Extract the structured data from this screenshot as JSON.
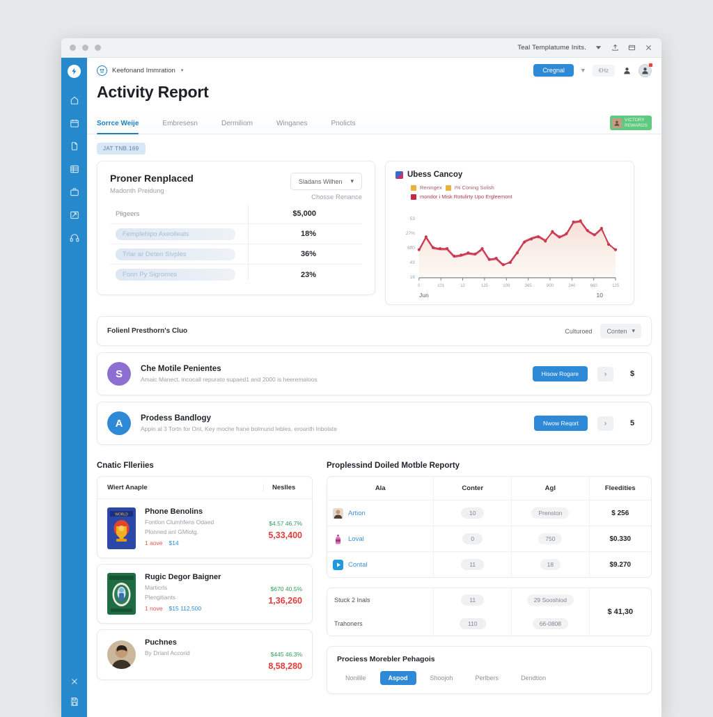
{
  "titlebar": {
    "title": "Teal Templatume Inits.",
    "icons": [
      "chevron-down-icon",
      "share-icon",
      "window-icon",
      "close-icon"
    ]
  },
  "sidebar": {
    "logo": "app-logo-icon",
    "items": [
      {
        "name": "home-icon"
      },
      {
        "name": "calendar-icon"
      },
      {
        "name": "document-icon"
      },
      {
        "name": "table-icon"
      },
      {
        "name": "briefcase-icon"
      },
      {
        "name": "send-icon"
      },
      {
        "name": "headset-icon"
      }
    ],
    "bottom": [
      {
        "name": "close-icon"
      },
      {
        "name": "save-icon"
      }
    ]
  },
  "topbar": {
    "brand": "Keefonand Immration",
    "brand_caret": "▾",
    "primary_button": "Cregnal",
    "filter_icon": "filter-icon",
    "ghost_pill": "€Hz",
    "user_icon": "user-icon",
    "avatar_icon": "avatar-icon"
  },
  "page_title": "Activity Report",
  "tabs": [
    {
      "label": "Sorrce Weije",
      "active": true
    },
    {
      "label": "Embresesn",
      "active": false
    },
    {
      "label": "Dermiliom",
      "active": false
    },
    {
      "label": "Winganes",
      "active": false
    },
    {
      "label": "Pnolicts",
      "active": false
    }
  ],
  "tab_badge": {
    "line1": "VICTORY",
    "line2": "REWARDS"
  },
  "filter_chip": "JAT TNB.169",
  "metrics": {
    "title": "Proner Renplaced",
    "subtitle": "Madonth Preidung",
    "select_value": "Sladans Wilhen",
    "choose_label": "Chosse Renance",
    "rows": [
      {
        "label": "Pligeers",
        "value": "$5,000",
        "skeleton": false
      },
      {
        "label": "Femplehipo Axeolleats",
        "value": "18%",
        "skeleton": true
      },
      {
        "label": "Trlar ar Deten Sivples",
        "value": "36%",
        "skeleton": true
      },
      {
        "label": "Fonn Py Sigromes",
        "value": "23%",
        "skeleton": true
      }
    ]
  },
  "chart_data": {
    "type": "line",
    "title": "Ubess Cancoy",
    "legend": [
      {
        "label": "Reningex",
        "color": "#e8b23c"
      },
      {
        "label": "I% Coning Solish",
        "color": "#e8b23c"
      },
      {
        "label": "mondor i Misk Rotulirty Upo Ergleemont",
        "color": "#c02a42"
      }
    ],
    "legend_position": "top-left",
    "grid": false,
    "xlabel": "",
    "ylabel": "",
    "ytick_labels": [
      "53",
      "27%",
      "6ff0",
      "43",
      "16"
    ],
    "xtick_labels": [
      "0",
      "101",
      "12",
      "125",
      "109",
      "365",
      "900",
      "240",
      "660",
      "125"
    ],
    "xaxis_captions": [
      "Jun",
      "10"
    ],
    "ylim": [
      0,
      100
    ],
    "series": [
      {
        "name": "mondor i Misk Rotulirty Upo Ergleemont",
        "color": "#c8394f",
        "values": [
          50,
          62,
          52,
          51,
          51,
          44,
          45,
          47,
          46,
          51,
          41,
          42,
          36,
          38,
          47,
          57,
          60,
          62,
          58,
          67,
          62,
          65,
          76,
          77,
          68,
          64,
          70,
          55,
          50
        ]
      },
      {
        "name": "Reningex",
        "color": "#d9536b",
        "values": [
          49,
          61,
          51,
          50,
          50,
          43,
          44,
          46,
          45,
          50,
          40,
          41,
          35,
          39,
          48,
          58,
          61,
          63,
          59,
          66,
          61,
          64,
          75,
          76,
          67,
          63,
          69,
          56,
          49
        ]
      }
    ]
  },
  "report_panel": {
    "title": "Folienl Presthorn's Cluo",
    "link": "Culturoed",
    "select": "Conten",
    "items": [
      {
        "initial": "S",
        "avatar_color": "#8d6fd1",
        "title": "Che Motile Penientes",
        "desc": "Amaic Manect, incocall repurato supaed1 and 2000 is heeremaloos",
        "button": "Hisow Rogare",
        "chevron": "›",
        "amount": "$"
      },
      {
        "initial": "A",
        "avatar_color": "#2e8ad6",
        "title": "Prodess Bandlogy",
        "desc": "Appin al 3 Tortn for Ont, Key moche frane bolmund lebles, eroanth Inbolate",
        "button": "Nwow Reqort",
        "chevron": "›",
        "amount": "5"
      }
    ]
  },
  "products": {
    "section_title": "Cnatic Flleriies",
    "col_name": "Wiert Anaple",
    "col_value": "Neslles",
    "items": [
      {
        "thumb": "trophy-poster-thumb",
        "name": "Phone Benolins",
        "line1": "Fontlon Clumhfens Odaed",
        "line2": "Plonned anl GMlotg.",
        "move": "1 aove",
        "price": "$14",
        "pct": "$4.57 46.7%",
        "amount": "5,33,400"
      },
      {
        "thumb": "green-poster-thumb",
        "name": "Rugic Degor Baigner",
        "line1": "Marticrls",
        "line2": "Plengitiants",
        "move": "1 nove",
        "price": "$15 112,500",
        "pct": "$670 40.5%",
        "amount": "1,36,260"
      },
      {
        "thumb": "person-photo-thumb",
        "name": "Puchnes",
        "line1": "By Drianl Accorid",
        "line2": "",
        "move": "",
        "price": "",
        "pct": "$445 46.3%",
        "amount": "8,58,280"
      }
    ]
  },
  "report_table": {
    "section_title": "Proplessind Doiled Motble Reporty",
    "headers": [
      "Ala",
      "Conter",
      "Agl",
      "Fleedities"
    ],
    "rows": [
      {
        "icon": "person-avatar-icon",
        "name": "Artion",
        "count": "10",
        "tag": "Prenston",
        "amount": "$ 256"
      },
      {
        "icon": "bottle-icon",
        "name": "Loval",
        "count": "0",
        "tag": "750",
        "amount": "$0.330"
      },
      {
        "icon": "play-icon",
        "name": "Contal",
        "count": "11",
        "tag": "18",
        "amount": "$9.270"
      }
    ],
    "summary": {
      "labels": [
        "Stuck 2 Inals",
        "Trahoners"
      ],
      "counts": [
        "11",
        "110"
      ],
      "tags": [
        "29 Sooshiod",
        "66-0808"
      ],
      "amount": "$ 41,30"
    }
  },
  "segments": {
    "title": "Prociess Morebler Pehagois",
    "tabs": [
      {
        "label": "Nonilile",
        "active": false
      },
      {
        "label": "Aspod",
        "active": true
      },
      {
        "label": "Shoojoh",
        "active": false
      },
      {
        "label": "Perlbers",
        "active": false
      },
      {
        "label": "Dendtion",
        "active": false
      }
    ]
  },
  "colors": {
    "sidebar": "#2689cb",
    "accent": "#2e8ad6",
    "chart_line": "#c8394f",
    "positive": "#2e9e5b",
    "negative": "#e23b3b"
  }
}
